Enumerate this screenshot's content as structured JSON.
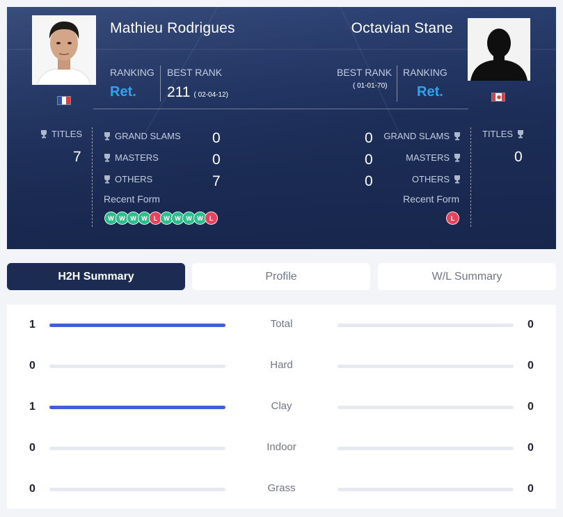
{
  "player1": {
    "name": "Mathieu Rodrigues",
    "ranking_label": "RANKING",
    "ranking_value": "Ret.",
    "best_rank_label": "BEST RANK",
    "best_rank_value": "211",
    "best_rank_date": "( 02-04-12)",
    "country": "France",
    "titles_label": "TITLES",
    "titles_value": "7",
    "stats": [
      {
        "label": "GRAND SLAMS",
        "value": "0"
      },
      {
        "label": "MASTERS",
        "value": "0"
      },
      {
        "label": "OTHERS",
        "value": "7"
      }
    ],
    "recent_form_label": "Recent Form",
    "recent_form": [
      "W",
      "W",
      "W",
      "W",
      "L",
      "W",
      "W",
      "W",
      "W",
      "L"
    ]
  },
  "player2": {
    "name": "Octavian Stane",
    "ranking_label": "RANKING",
    "ranking_value": "Ret.",
    "best_rank_label": "BEST RANK",
    "best_rank_date": "( 01-01-70)",
    "country": "Canada",
    "titles_label": "TITLES",
    "titles_value": "0",
    "stats": [
      {
        "label": "GRAND SLAMS",
        "value": "0"
      },
      {
        "label": "MASTERS",
        "value": "0"
      },
      {
        "label": "OTHERS",
        "value": "0"
      }
    ],
    "recent_form_label": "Recent Form",
    "recent_form": [
      "L"
    ]
  },
  "tabs": [
    {
      "label": "H2H Summary",
      "active": true
    },
    {
      "label": "Profile",
      "active": false
    },
    {
      "label": "W/L Summary",
      "active": false
    }
  ],
  "h2h": [
    {
      "category": "Total",
      "p1": "1",
      "p2": "0",
      "p1_fraction": 1,
      "p2_fraction": 0
    },
    {
      "category": "Hard",
      "p1": "0",
      "p2": "0",
      "p1_fraction": 0,
      "p2_fraction": 0
    },
    {
      "category": "Clay",
      "p1": "1",
      "p2": "0",
      "p1_fraction": 1,
      "p2_fraction": 0
    },
    {
      "category": "Indoor",
      "p1": "0",
      "p2": "0",
      "p1_fraction": 0,
      "p2_fraction": 0
    },
    {
      "category": "Grass",
      "p1": "0",
      "p2": "0",
      "p1_fraction": 0,
      "p2_fraction": 0
    }
  ],
  "colors": {
    "accent_blue": "#2aa5ee",
    "win_badge": "#27bf8c",
    "loss_badge": "#e8435c",
    "bar_fill": "#3f61d6",
    "active_tab": "#1b2b52"
  },
  "icons": {
    "trophy": "trophy-icon",
    "avatar_placeholder": "silhouette-icon"
  }
}
